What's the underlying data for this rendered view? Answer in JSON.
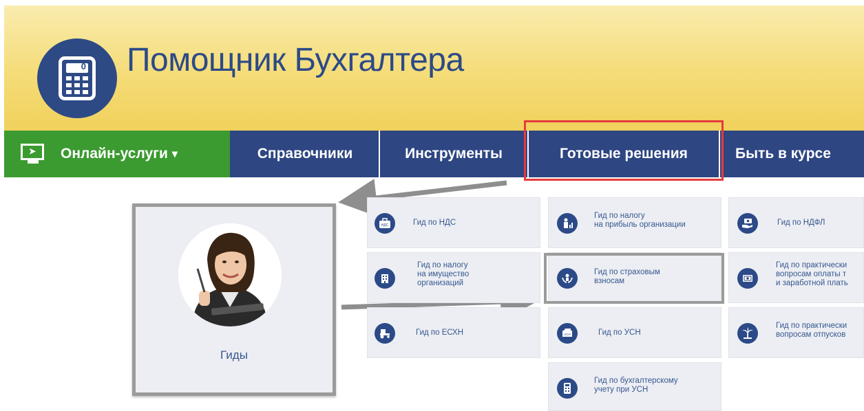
{
  "header": {
    "title": "Помощник Бухгалтера",
    "logo_digit": "0"
  },
  "nav": {
    "online": "Онлайн-услуги",
    "online_caret": "▾",
    "directories": "Справочники",
    "tools": "Инструменты",
    "ready_solutions": "Готовые решения",
    "stay_informed": "Быть в курсе"
  },
  "guides": {
    "label": "Гиды"
  },
  "tiles": {
    "vat": "Гид по НДС",
    "profit_tax": "Гид по налогу\nна прибыль организации",
    "ndfl": "Гид по НДФЛ",
    "property_tax": "Гид по налогу\nна имущество\nорганизаций",
    "insurance": "Гид по страховым\nвзносам",
    "salary": "Гид по практически\nвопросам оплаты т\nи заработной плать",
    "eskhn": "Гид по ЕСХН",
    "usn": "Гид по УСН",
    "vacation": "Гид по практически\nвопросам отпусков",
    "usn_accounting": "Гид по бухгалтерскому\nучету при УСН"
  },
  "icons": {
    "vat_badge": "НДС",
    "usn_badge": "УСН"
  },
  "colors": {
    "brand_blue": "#2e4682",
    "online_green": "#3b9a30",
    "header_yellow": "#f5dc78",
    "highlight_red": "#e63b3b",
    "tile_bg": "#eceef3"
  }
}
